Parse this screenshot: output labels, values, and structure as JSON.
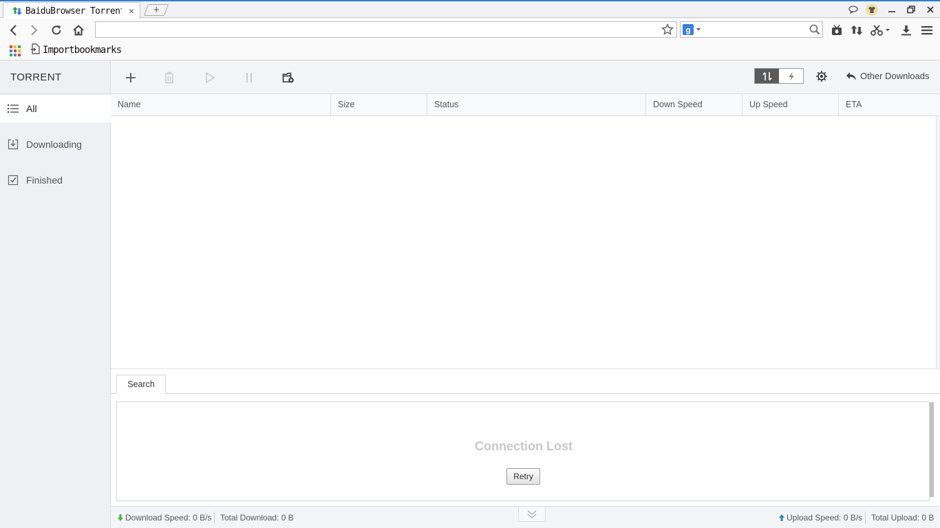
{
  "browser": {
    "tab": {
      "title": "BaiduBrowser Torrent",
      "close": "×"
    },
    "new_tab": "+",
    "address": {
      "value": "",
      "placeholder": ""
    },
    "search": {
      "value": "",
      "placeholder": ""
    },
    "bookmarks": {
      "import_label": "Importbookmarks"
    }
  },
  "app": {
    "title": "TORRENT",
    "sidebar": [
      {
        "label": "All",
        "icon": "list-icon",
        "active": true
      },
      {
        "label": "Downloading",
        "icon": "download-tray-icon",
        "active": false
      },
      {
        "label": "Finished",
        "icon": "checkbox-icon",
        "active": false
      }
    ],
    "toolbar": {
      "other_downloads": "Other Downloads"
    },
    "columns": [
      "Name",
      "Size",
      "Status",
      "Down Speed",
      "Up Speed",
      "ETA"
    ],
    "panel": {
      "tab": "Search",
      "message": "Connection Lost",
      "retry": "Retry"
    },
    "status": {
      "download_speed": "Download Speed: 0 B/s",
      "total_download": "Total Download: 0 B",
      "upload_speed": "Upload Speed: 0 B/s",
      "total_upload": "Total Upload: 0 B"
    }
  },
  "colors": {
    "accent": "#2a7fd4",
    "download_arrow": "#4caf50",
    "upload_arrow": "#2a7fd4"
  }
}
